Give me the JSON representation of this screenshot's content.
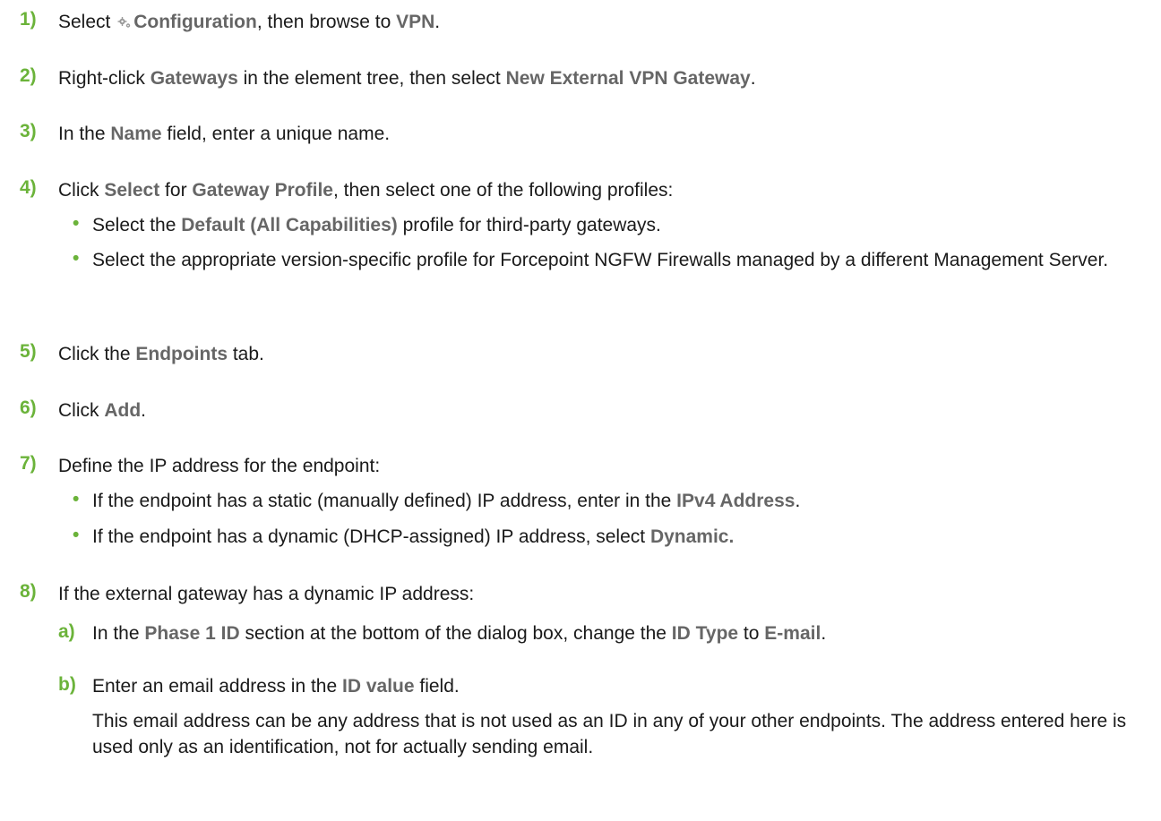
{
  "steps": {
    "s1": {
      "num": "1)",
      "t1": "Select ",
      "icon": "gear-icon",
      "t2": "Configuration",
      "t3": ", then browse to ",
      "t4": "VPN",
      "t5": "."
    },
    "s2": {
      "num": "2)",
      "t1": "Right-click ",
      "t2": "Gateways",
      "t3": " in the element tree, then select ",
      "t4": "New External VPN Gateway",
      "t5": "."
    },
    "s3": {
      "num": "3)",
      "t1": "In the ",
      "t2": "Name",
      "t3": " field, enter a unique name."
    },
    "s4": {
      "num": "4)",
      "t1": "Click ",
      "t2": "Select",
      "t3": " for ",
      "t4": "Gateway Profile",
      "t5": ", then select one of the following profiles:",
      "b1": {
        "t1": "Select the ",
        "t2": "Default (All Capabilities)",
        "t3": " profile for third-party gateways."
      },
      "b2": {
        "t1": "Select the appropriate version-specific profile for Forcepoint NGFW Firewalls managed by a different Management Server."
      }
    },
    "s5": {
      "num": "5)",
      "t1": "Click the ",
      "t2": "Endpoints",
      "t3": " tab."
    },
    "s6": {
      "num": "6)",
      "t1": "Click ",
      "t2": "Add",
      "t3": "."
    },
    "s7": {
      "num": "7)",
      "t1": "Define the IP address for the endpoint:",
      "b1": {
        "t1": "If the endpoint has a static (manually defined) IP address, enter in the ",
        "t2": "IPv4 Address",
        "t3": "."
      },
      "b2": {
        "t1": "If the endpoint has a dynamic (DHCP-assigned) IP address, select ",
        "t2": "Dynamic."
      }
    },
    "s8": {
      "num": "8)",
      "t1": "If the external gateway has a dynamic IP address:",
      "a": {
        "num": "a)",
        "t1": "In the ",
        "t2": "Phase 1 ID",
        "t3": " section at the bottom of the dialog box, change the ",
        "t4": "ID Type",
        "t5": " to ",
        "t6": "E-mail",
        "t7": "."
      },
      "b": {
        "num": "b)",
        "t1": "Enter an email address in the ",
        "t2": "ID value",
        "t3": " field.",
        "note": "This email address can be any address that is not used as an ID in any of your other endpoints. The address entered here is used only as an identification, not for actually sending email."
      }
    }
  },
  "bullet_char": "•"
}
